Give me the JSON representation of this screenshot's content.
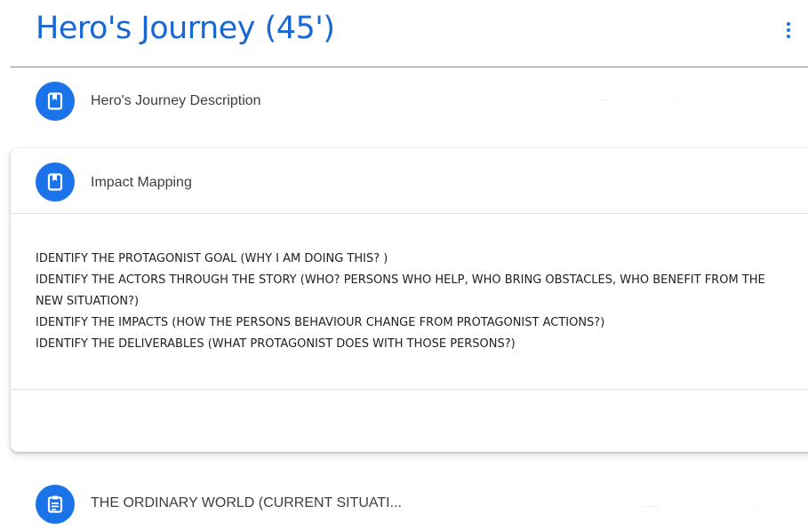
{
  "topic": {
    "title": "Hero's Journey (45')",
    "more_icon": "more-vert-icon",
    "accent_color": "#1a73e8"
  },
  "items": [
    {
      "title": "Hero's Journey Description",
      "icon": "material-icon",
      "expanded": false
    },
    {
      "title": "Impact Mapping",
      "icon": "material-icon",
      "expanded": true,
      "description_lines": [
        "IDENTIFY THE PROTAGONIST GOAL (WHY I AM DOING THIS? )",
        "IDENTIFY THE ACTORS THROUGH THE STORY (WHO? PERSONS WHO HELP, WHO BRING OBSTACLES, WHO BENEFIT FROM THE NEW SITUATION?)",
        "IDENTIFY THE IMPACTS (HOW THE PERSONS BEHAVIOUR CHANGE FROM PROTAGONIST ACTIONS?)",
        "IDENTIFY THE DELIVERABLES (WHAT PROTAGONIST DOES WITH THOSE PERSONS?)"
      ]
    },
    {
      "title": "THE ORDINARY WORLD (CURRENT SITUATI...",
      "icon": "assignment-icon",
      "expanded": false
    }
  ]
}
